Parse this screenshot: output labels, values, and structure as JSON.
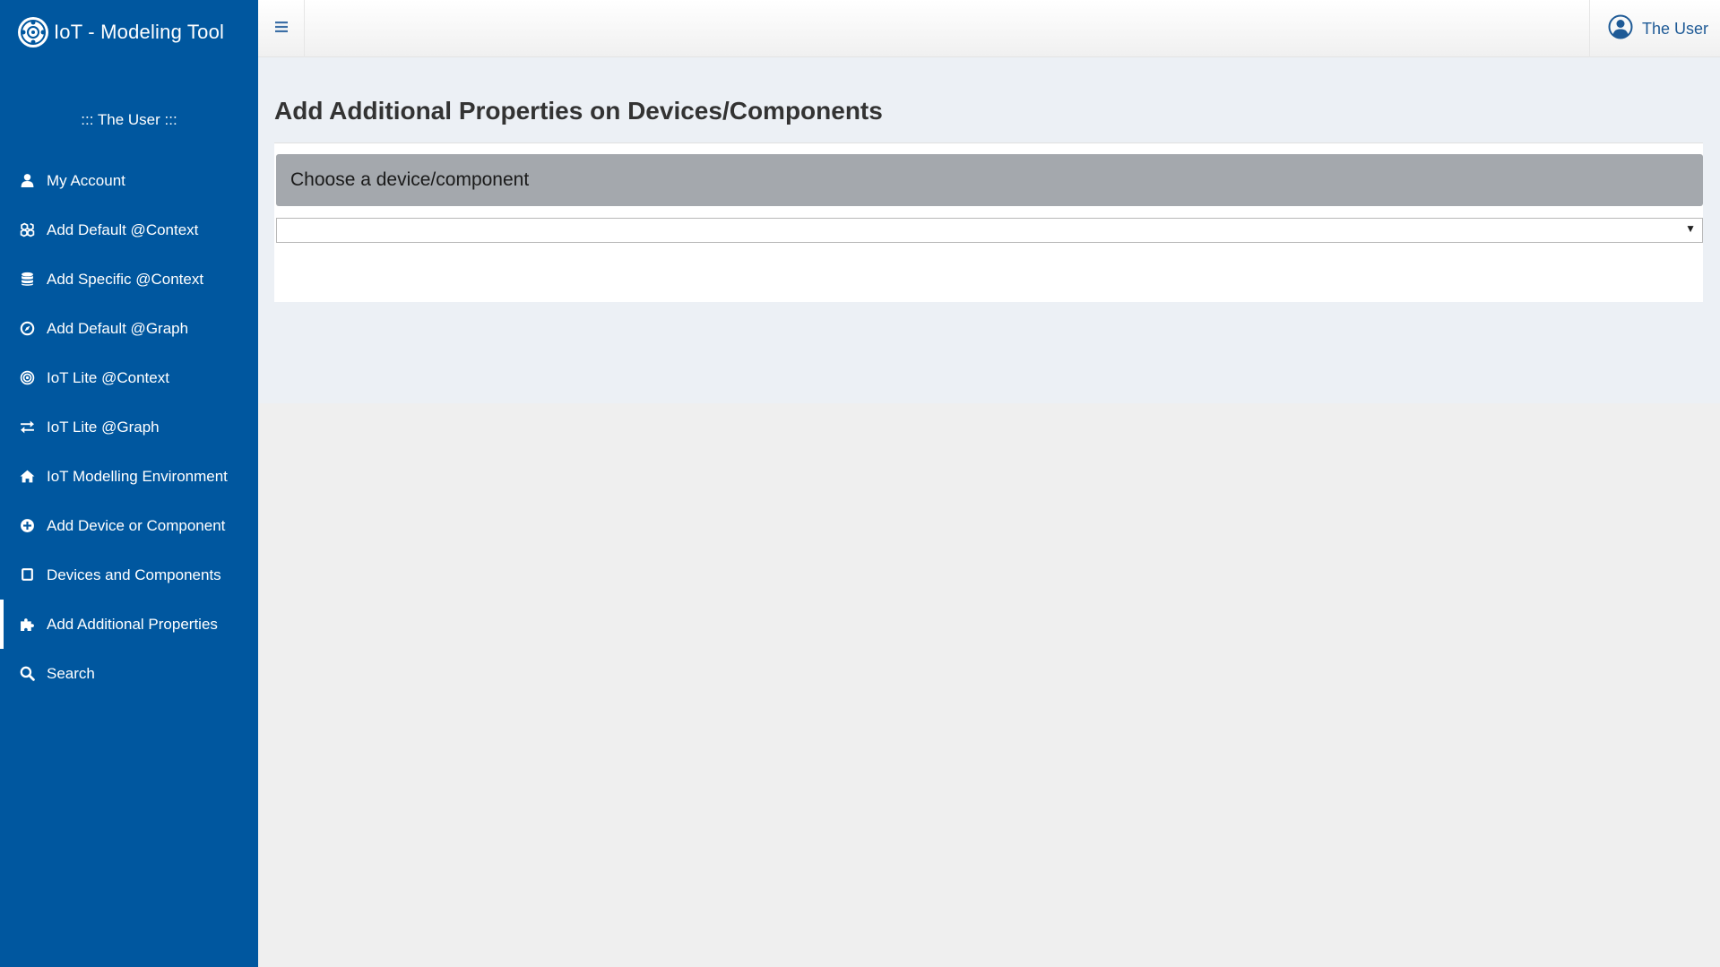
{
  "app": {
    "title": "IoT - Modeling Tool",
    "brand_color": "#00579f"
  },
  "sidebar": {
    "user_line": "::: The User :::",
    "items": [
      {
        "label": "My Account",
        "icon": "user-icon"
      },
      {
        "label": "Add Default @Context",
        "icon": "cubes-icon"
      },
      {
        "label": "Add Specific @Context",
        "icon": "database-icon"
      },
      {
        "label": "Add Default @Graph",
        "icon": "compass-icon"
      },
      {
        "label": "IoT Lite @Context",
        "icon": "bullseye-icon"
      },
      {
        "label": "IoT Lite @Graph",
        "icon": "exchange-icon"
      },
      {
        "label": "IoT Modelling Environment",
        "icon": "home-icon"
      },
      {
        "label": "Add Device or Component",
        "icon": "plus-circle-icon"
      },
      {
        "label": "Devices and Components",
        "icon": "square-icon"
      },
      {
        "label": "Add Additional Properties",
        "icon": "puzzle-icon",
        "active": true
      },
      {
        "label": "Search",
        "icon": "search-icon"
      }
    ]
  },
  "header": {
    "user_name": "The User"
  },
  "main": {
    "page_title": "Add Additional Properties on Devices/Components",
    "panel_title": "Choose a device/component",
    "select_value": ""
  }
}
